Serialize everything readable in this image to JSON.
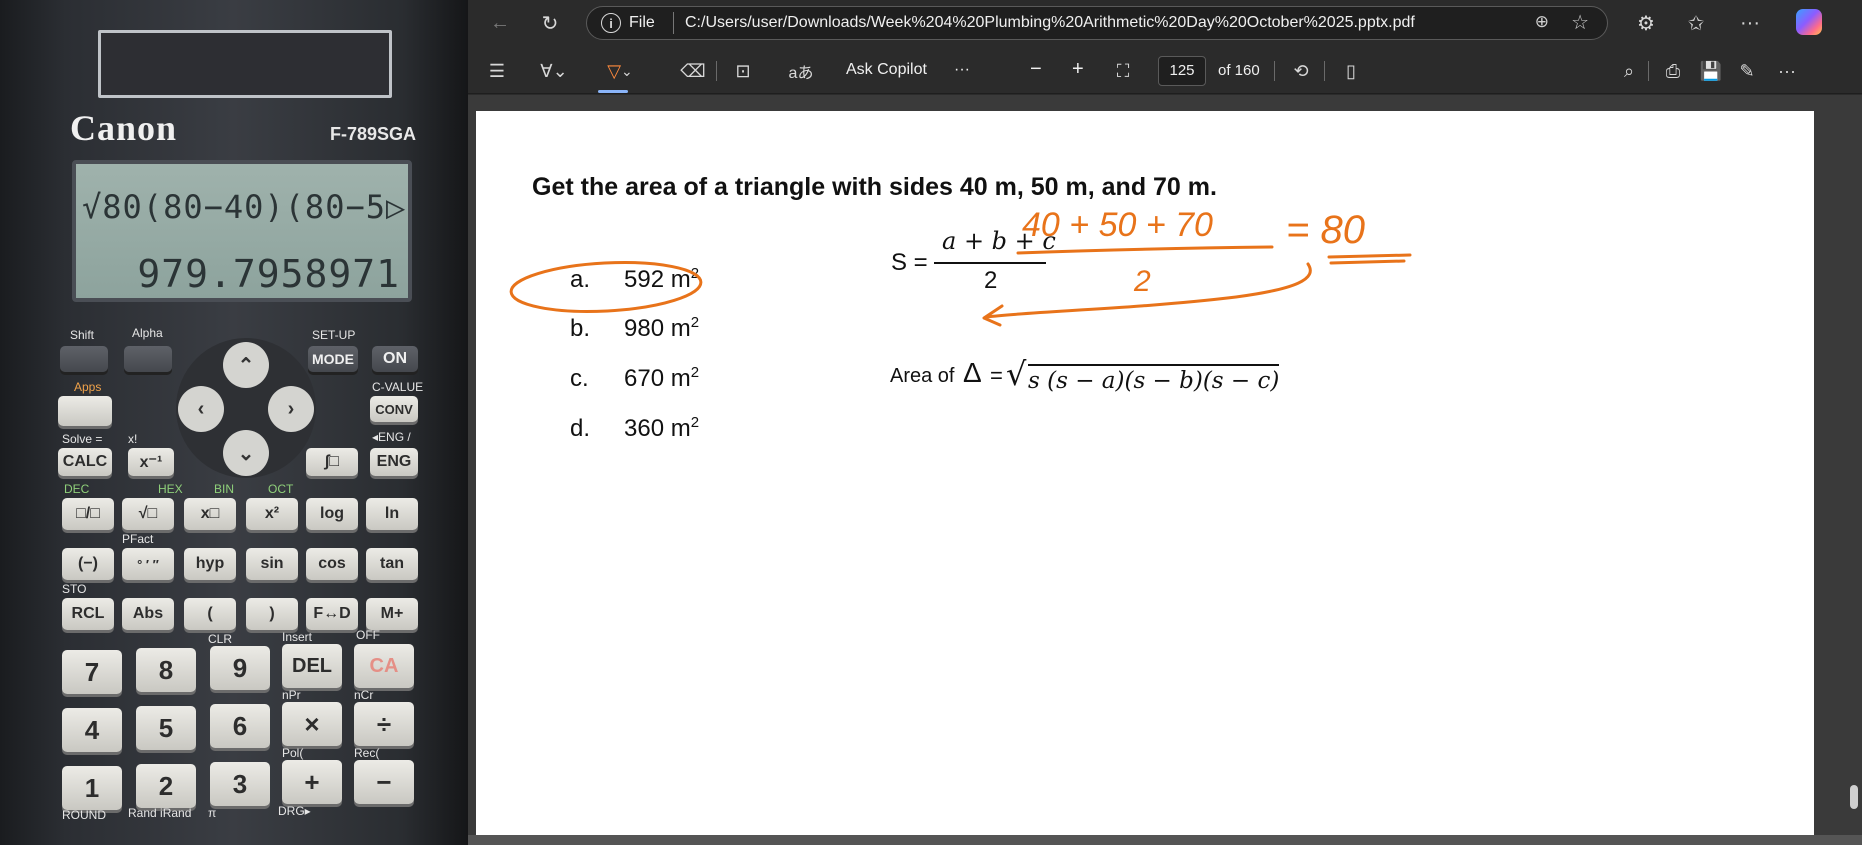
{
  "calculator": {
    "brand": "Canon",
    "model": "F-789SGA",
    "display_input": "√80(80−40)(80−5▷",
    "display_result": "979.7958971",
    "labels": {
      "shift": "Shift",
      "alpha": "Alpha",
      "setup": "SET-UP",
      "apps": "Apps",
      "cvalue": "C-VALUE",
      "solve": "Solve =",
      "xfact": "x!",
      "eng_shift": "◂ENG /",
      "clr": "CLR",
      "insert": "Insert",
      "off": "OFF",
      "npr": "nPr",
      "ncr": "nCr",
      "pol": "Pol(",
      "rec": "Rec(",
      "round": "ROUND",
      "rand": "Rand iRand",
      "pi": "π",
      "drg": "DRG▸",
      "sto": "STO",
      "pfact": "PFact",
      "dec": "DEC",
      "hex": "HEX",
      "bin": "BIN",
      "oct": "OCT"
    },
    "keys": {
      "mode": "MODE",
      "on": "ON",
      "conv": "CONV",
      "calc": "CALC",
      "inv": "x⁻¹",
      "int": "∫□",
      "eng": "ENG",
      "frac": "□/□",
      "sqrt": "√□",
      "pow": "x□",
      "sq": "x²",
      "log": "log",
      "ln": "ln",
      "neg": "(−)",
      "dms": "° ′ ″",
      "hyp": "hyp",
      "sin": "sin",
      "cos": "cos",
      "tan": "tan",
      "rcl": "RCL",
      "abs": "Abs",
      "lparen": "(",
      "rparen": ")",
      "fd": "F↔D",
      "mplus": "M+",
      "k7": "7",
      "k8": "8",
      "k9": "9",
      "del": "DEL",
      "ca": "CA",
      "k4": "4",
      "k5": "5",
      "k6": "6",
      "mul": "×",
      "div": "÷",
      "k1": "1",
      "k2": "2",
      "k3": "3",
      "plus": "+",
      "minus": "−"
    }
  },
  "browser": {
    "scheme": "File",
    "url": "C:/Users/user/Downloads/Week%204%20Plumbing%20Arithmetic%20Day%20October%2025.pptx.pdf",
    "toolbar": {
      "ask_copilot": "Ask Copilot",
      "more": "···",
      "zoom_out": "−",
      "zoom_in": "+",
      "page_current": "125",
      "page_total": "of 160"
    }
  },
  "slide": {
    "question": "Get the area of a triangle with sides 40 m, 50 m, and 70 m.",
    "options": [
      {
        "letter": "a.",
        "value": "592 m",
        "unit_exp": "2"
      },
      {
        "letter": "b.",
        "value": "980 m",
        "unit_exp": "2"
      },
      {
        "letter": "c.",
        "value": "670 m",
        "unit_exp": "2"
      },
      {
        "letter": "d.",
        "value": "360 m",
        "unit_exp": "2"
      }
    ],
    "formula_s_label": "S =",
    "formula_numerator": "a + b + c",
    "formula_denominator": "2",
    "area_label": "Area of",
    "area_delta": "Δ",
    "area_eq": "=",
    "area_radicand": "s (s − a)(s − b)(s − c)",
    "handwriting": {
      "numerator": "40 + 50 + 70",
      "denominator": "2",
      "result": "= 80",
      "ink_color": "#e8731a"
    }
  }
}
